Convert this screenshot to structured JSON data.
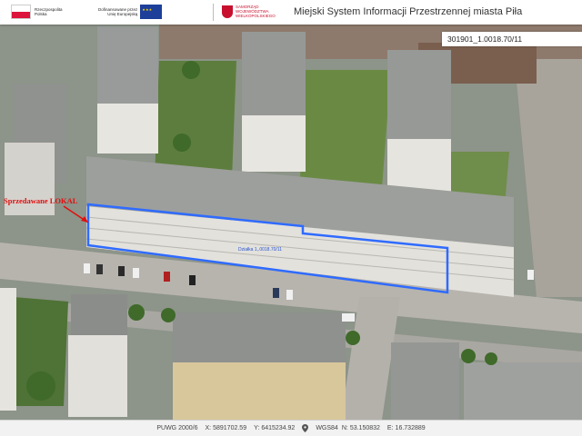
{
  "header": {
    "logo_rp_line1": "Rzeczpospolita",
    "logo_rp_line2": "Polska",
    "logo_ue_line1": "Dofinansowane przez",
    "logo_ue_line2": "Unię Europejską",
    "logo_woj_line1": "SAMORZĄD",
    "logo_woj_line2": "WOJEWÓDZTWA",
    "logo_woj_line3": "WIELKOPOLSKIEGO",
    "title": "Miejski System Informacji Przestrzennej miasta Piła"
  },
  "map": {
    "parcel_id": "301901_1.0018.70/11",
    "annotation": "Sprzedawane LOKAL",
    "area_label": "Działka 1,.0018.70/11",
    "colors": {
      "highlight": "#2f6bff",
      "annotation": "#e01010",
      "roof": "#9b9d9a",
      "road": "#b3b1ad"
    }
  },
  "footer": {
    "coord_system": "PUWG 2000/6",
    "x_label": "X:",
    "x_value": "5891702.59",
    "y_label": "Y:",
    "y_value": "6415234.92",
    "wgs_label": "WGS84",
    "n_label": "N:",
    "n_value": "53.150832",
    "e_label": "E:",
    "e_value": "16.732889"
  }
}
